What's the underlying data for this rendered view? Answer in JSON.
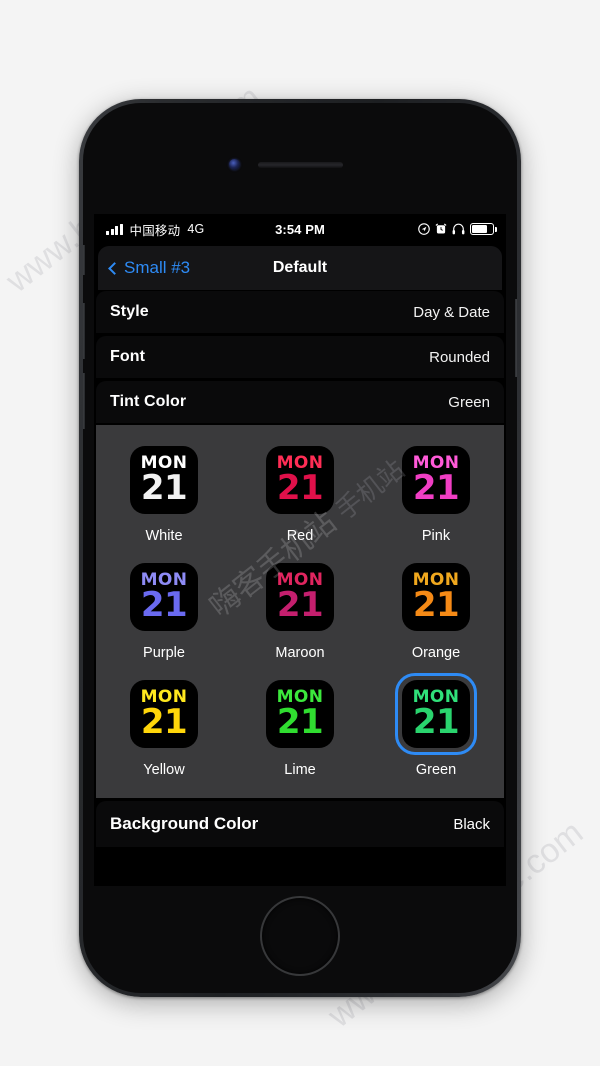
{
  "watermark": {
    "left": "www.hackhome.com",
    "right": "www.hackhome.com",
    "cn_1": "嗨客手机站",
    "cn_2": "手机站"
  },
  "statusbar": {
    "carrier": "中国移动",
    "network": "4G",
    "time": "3:54 PM",
    "icons": [
      "location-arrow-icon",
      "alarm-clock-icon",
      "headphones-icon",
      "battery-icon"
    ]
  },
  "navbar": {
    "back_label": "Small #3",
    "title": "Default"
  },
  "settings_rows": [
    {
      "label": "Style",
      "value": "Day & Date"
    },
    {
      "label": "Font",
      "value": "Rounded"
    },
    {
      "label": "Tint Color",
      "value": "Green"
    }
  ],
  "tint_grid": {
    "preview_day": "MON",
    "preview_date": "21",
    "selected": "Green",
    "selection_ring_color": "#2e8bf5",
    "tile_background": "#000000",
    "rows": [
      [
        {
          "name": "White",
          "top_color": "#ffffff",
          "bottom_color": "#f2f2f2"
        },
        {
          "name": "Red",
          "top_color": "#ff2d55",
          "bottom_color": "#e0104a"
        },
        {
          "name": "Pink",
          "top_color": "#ff5ad8",
          "bottom_color": "#f03ec4"
        }
      ],
      [
        {
          "name": "Purple",
          "top_color": "#8e8bf5",
          "bottom_color": "#6a6af0"
        },
        {
          "name": "Maroon",
          "top_color": "#e0255f",
          "bottom_color": "#c41f6e"
        },
        {
          "name": "Orange",
          "top_color": "#f0a81e",
          "bottom_color": "#f58a16"
        }
      ],
      [
        {
          "name": "Yellow",
          "top_color": "#ffe81e",
          "bottom_color": "#ffd60a"
        },
        {
          "name": "Lime",
          "top_color": "#3ce83c",
          "bottom_color": "#30dd30"
        },
        {
          "name": "Green",
          "top_color": "#30e07a",
          "bottom_color": "#2ad46e"
        }
      ]
    ]
  },
  "bottom_row": {
    "label": "Background Color",
    "value": "Black"
  }
}
